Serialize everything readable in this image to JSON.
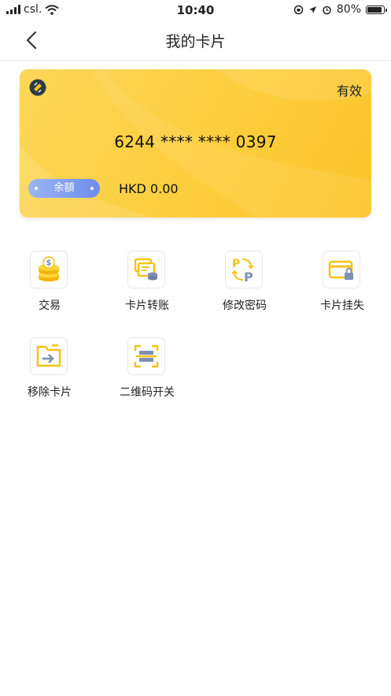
{
  "status_bar": {
    "carrier": "csl.",
    "time": "10:40",
    "battery": "80%"
  },
  "nav": {
    "title": "我的卡片",
    "back_icon": "chevron-left-icon"
  },
  "card": {
    "status": "有效",
    "number": "6244 **** **** 0397",
    "balance_label": "余額",
    "balance_value": "HKD 0.00",
    "colors": {
      "card_start": "#fdd75a",
      "card_end": "#fbc52b",
      "pill_start": "#9db5f4",
      "pill_end": "#6d8cee"
    }
  },
  "menu": {
    "items": [
      {
        "label": "交易",
        "icon": "coins-icon"
      },
      {
        "label": "卡片转账",
        "icon": "card-transfer-icon"
      },
      {
        "label": "修改密码",
        "icon": "change-password-icon"
      },
      {
        "label": "卡片挂失",
        "icon": "card-lock-icon"
      },
      {
        "label": "移除卡片",
        "icon": "remove-card-icon"
      },
      {
        "label": "二维码开关",
        "icon": "qr-scan-icon"
      }
    ]
  },
  "colors": {
    "accent": "#f5c218",
    "icon_blue": "#7d8fb3"
  }
}
